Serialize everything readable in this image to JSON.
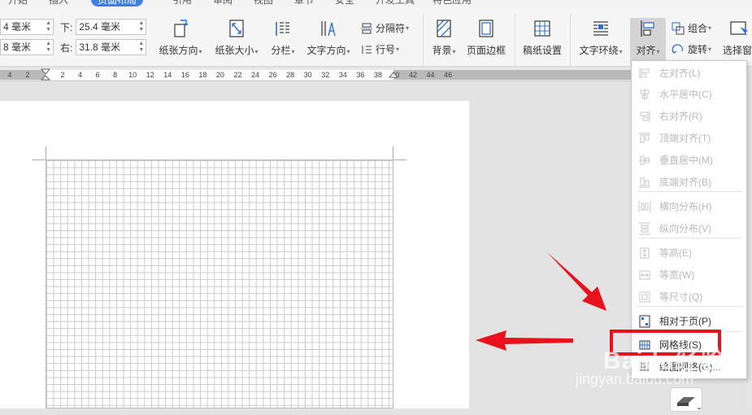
{
  "tabs": [
    "开始",
    "插入",
    "页面布局",
    "引用",
    "审阅",
    "视图",
    "章节",
    "安全",
    "开发工具",
    "特色应用"
  ],
  "margins": {
    "top_label": "",
    "top_value": "4 毫米",
    "bottom_label": "下:",
    "bottom_value": "25.4 毫米",
    "left_label": "",
    "left_value": "8 毫米",
    "right_label": "右:",
    "right_value": "31.8 毫米"
  },
  "ribbon": {
    "orientation": "纸张方向",
    "size": "纸张大小",
    "columns": "分栏",
    "text_direction": "文字方向",
    "section_break": "分隔符",
    "line_number": "行号",
    "background": "背景",
    "page_border": "页面边框",
    "paper_setup": "稿纸设置",
    "text_wrap": "文字环绕",
    "align": "对齐",
    "group": "组合",
    "rotate": "旋转",
    "select_pane": "选择窗"
  },
  "ruler_ticks": [
    "4",
    "2",
    "2",
    "4",
    "6",
    "8",
    "10",
    "12",
    "14",
    "16",
    "18",
    "20",
    "22",
    "24",
    "26",
    "28",
    "30",
    "32",
    "34",
    "36",
    "38",
    "40",
    "42",
    "44",
    "46"
  ],
  "align_menu": {
    "items": [
      {
        "label": "左对齐(L)",
        "enabled": false,
        "icon": "align-left-icon"
      },
      {
        "label": "水平居中(C)",
        "enabled": false,
        "icon": "align-center-icon"
      },
      {
        "label": "右对齐(R)",
        "enabled": false,
        "icon": "align-right-icon"
      },
      {
        "label": "顶端对齐(T)",
        "enabled": false,
        "icon": "align-top-icon"
      },
      {
        "label": "垂直居中(M)",
        "enabled": false,
        "icon": "align-middle-icon"
      },
      {
        "label": "底端对齐(B)",
        "enabled": false,
        "icon": "align-bottom-icon"
      },
      {
        "label": "横向分布(H)",
        "enabled": false,
        "icon": "distribute-horizontal-icon"
      },
      {
        "label": "纵向分布(V)",
        "enabled": false,
        "icon": "distribute-vertical-icon"
      },
      {
        "label": "等高(E)",
        "enabled": false,
        "icon": "equal-height-icon"
      },
      {
        "label": "等宽(W)",
        "enabled": false,
        "icon": "equal-width-icon"
      },
      {
        "label": "等尺寸(Q)",
        "enabled": false,
        "icon": "equal-size-icon"
      },
      {
        "label": "相对于页(P)",
        "enabled": true,
        "icon": "relative-to-page-icon"
      },
      {
        "label": "网格线(S)",
        "enabled": true,
        "icon": "gridlines-icon"
      },
      {
        "label": "绘图网格(G)...",
        "enabled": true,
        "icon": "drawing-grid-icon"
      }
    ]
  },
  "watermark": {
    "brand": "Baidu经验",
    "url": "jingyan.baidu.com"
  },
  "colors": {
    "accent": "#3f7fe4",
    "highlight": "#e8121c"
  }
}
